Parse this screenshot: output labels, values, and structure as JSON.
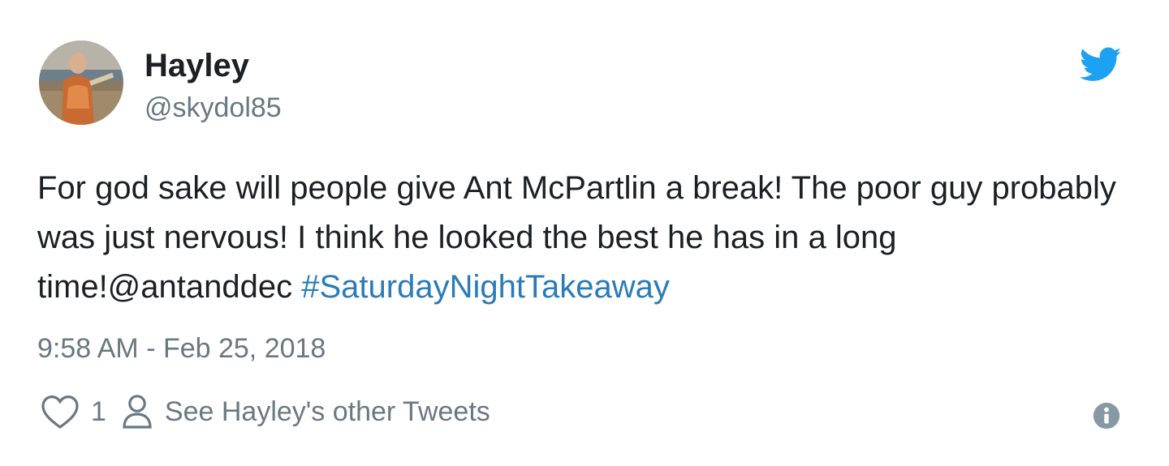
{
  "user": {
    "display_name": "Hayley",
    "handle": "@skydol85"
  },
  "tweet": {
    "text_main": "For god sake will people give Ant McPartlin a break! The poor guy probably was just nervous! I think he looked the best he has in a long time!@antanddec ",
    "hashtag": "#SaturdayNightTakeaway",
    "timestamp": "9:58 AM - Feb 25, 2018"
  },
  "actions": {
    "like_count": "1",
    "other_tweets_label": "See Hayley's other Tweets"
  },
  "icons": {
    "brand": "twitter-bird-icon",
    "like": "heart-icon",
    "profile": "person-icon",
    "info": "info-icon"
  },
  "colors": {
    "twitter_blue": "#1da1f2",
    "hashtag": "#2b7bb9",
    "secondary_text": "#697882",
    "primary_text": "#1c2022"
  }
}
